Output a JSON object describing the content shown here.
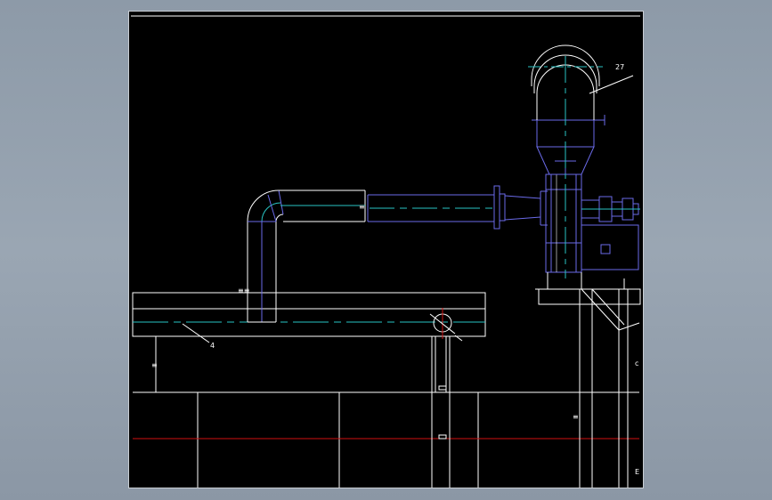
{
  "drawing": {
    "callouts": [
      {
        "id": "27",
        "text": "27"
      },
      {
        "id": "4",
        "text": "4"
      }
    ],
    "colors": {
      "background": "#000000",
      "outline": "#ffffff",
      "centerline": "#29c4c4",
      "equipment": "#6a6ae8",
      "datum": "#d01010",
      "frame": "#9aa6b3"
    }
  }
}
